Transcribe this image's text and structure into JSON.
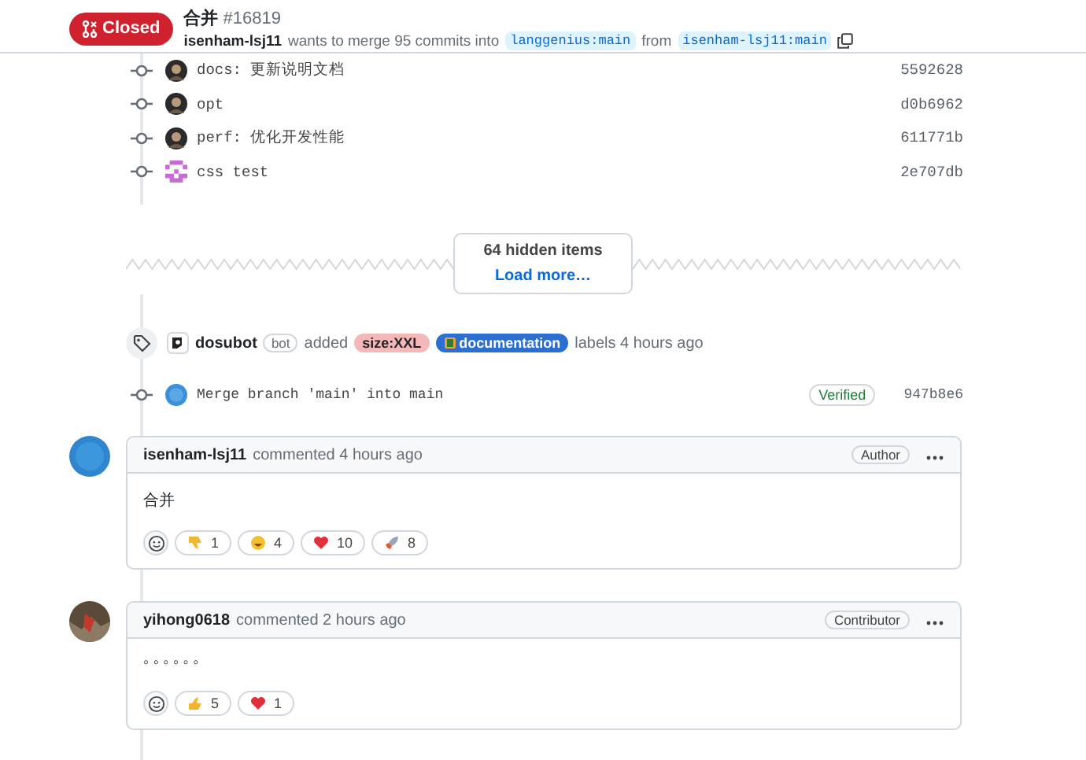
{
  "pull_request": {
    "state": "Closed",
    "closed": true,
    "title": "合并",
    "number": "#16819",
    "author": "isenham-lsj11",
    "summary": "wants to merge 95 commits into",
    "base_branch": "langgenius:main",
    "from_word": "from",
    "head_branch": "isenham-lsj11:main"
  },
  "commits": [
    {
      "message": "docs: 更新说明文档",
      "sha": "5592628",
      "kind": "photo"
    },
    {
      "message": "opt",
      "sha": "d0b6962",
      "kind": "photo"
    },
    {
      "message": "perf: 优化开发性能",
      "sha": "611771b",
      "kind": "photo"
    },
    {
      "message": "css test",
      "sha": "2e707db",
      "kind": "identicon"
    }
  ],
  "hidden_items": {
    "count": "64 hidden items",
    "link": "Load more…"
  },
  "label_event": {
    "actor": "dosubot",
    "actor_badge": "bot",
    "verb": "added",
    "labels": [
      {
        "name": "size:XXL",
        "color": "#f5b8b8"
      },
      {
        "name": "documentation",
        "color": "#2b6fd1"
      }
    ],
    "suffix": "labels 4 hours ago"
  },
  "merge_commit": {
    "message": "Merge branch 'main' into main",
    "verified": "Verified",
    "sha": "947b8e6"
  },
  "comments": [
    {
      "author": "isenham-lsj11",
      "action": "commented 4 hours ago",
      "role": "Author",
      "kind": "logo",
      "body": "合并",
      "reactions": [
        {
          "kind": "thumbs-down",
          "count": "1"
        },
        {
          "kind": "laugh",
          "count": "4"
        },
        {
          "kind": "heart",
          "count": "10"
        },
        {
          "kind": "rocket",
          "count": "8"
        }
      ]
    },
    {
      "author": "yihong0618",
      "action": "commented 2 hours ago",
      "role": "Contributor",
      "kind": "photo",
      "body": "◦ ◦ ◦ ◦ ◦ ◦",
      "reactions": [
        {
          "kind": "thumbs-up",
          "count": "5"
        },
        {
          "kind": "heart",
          "count": "1"
        }
      ]
    }
  ]
}
